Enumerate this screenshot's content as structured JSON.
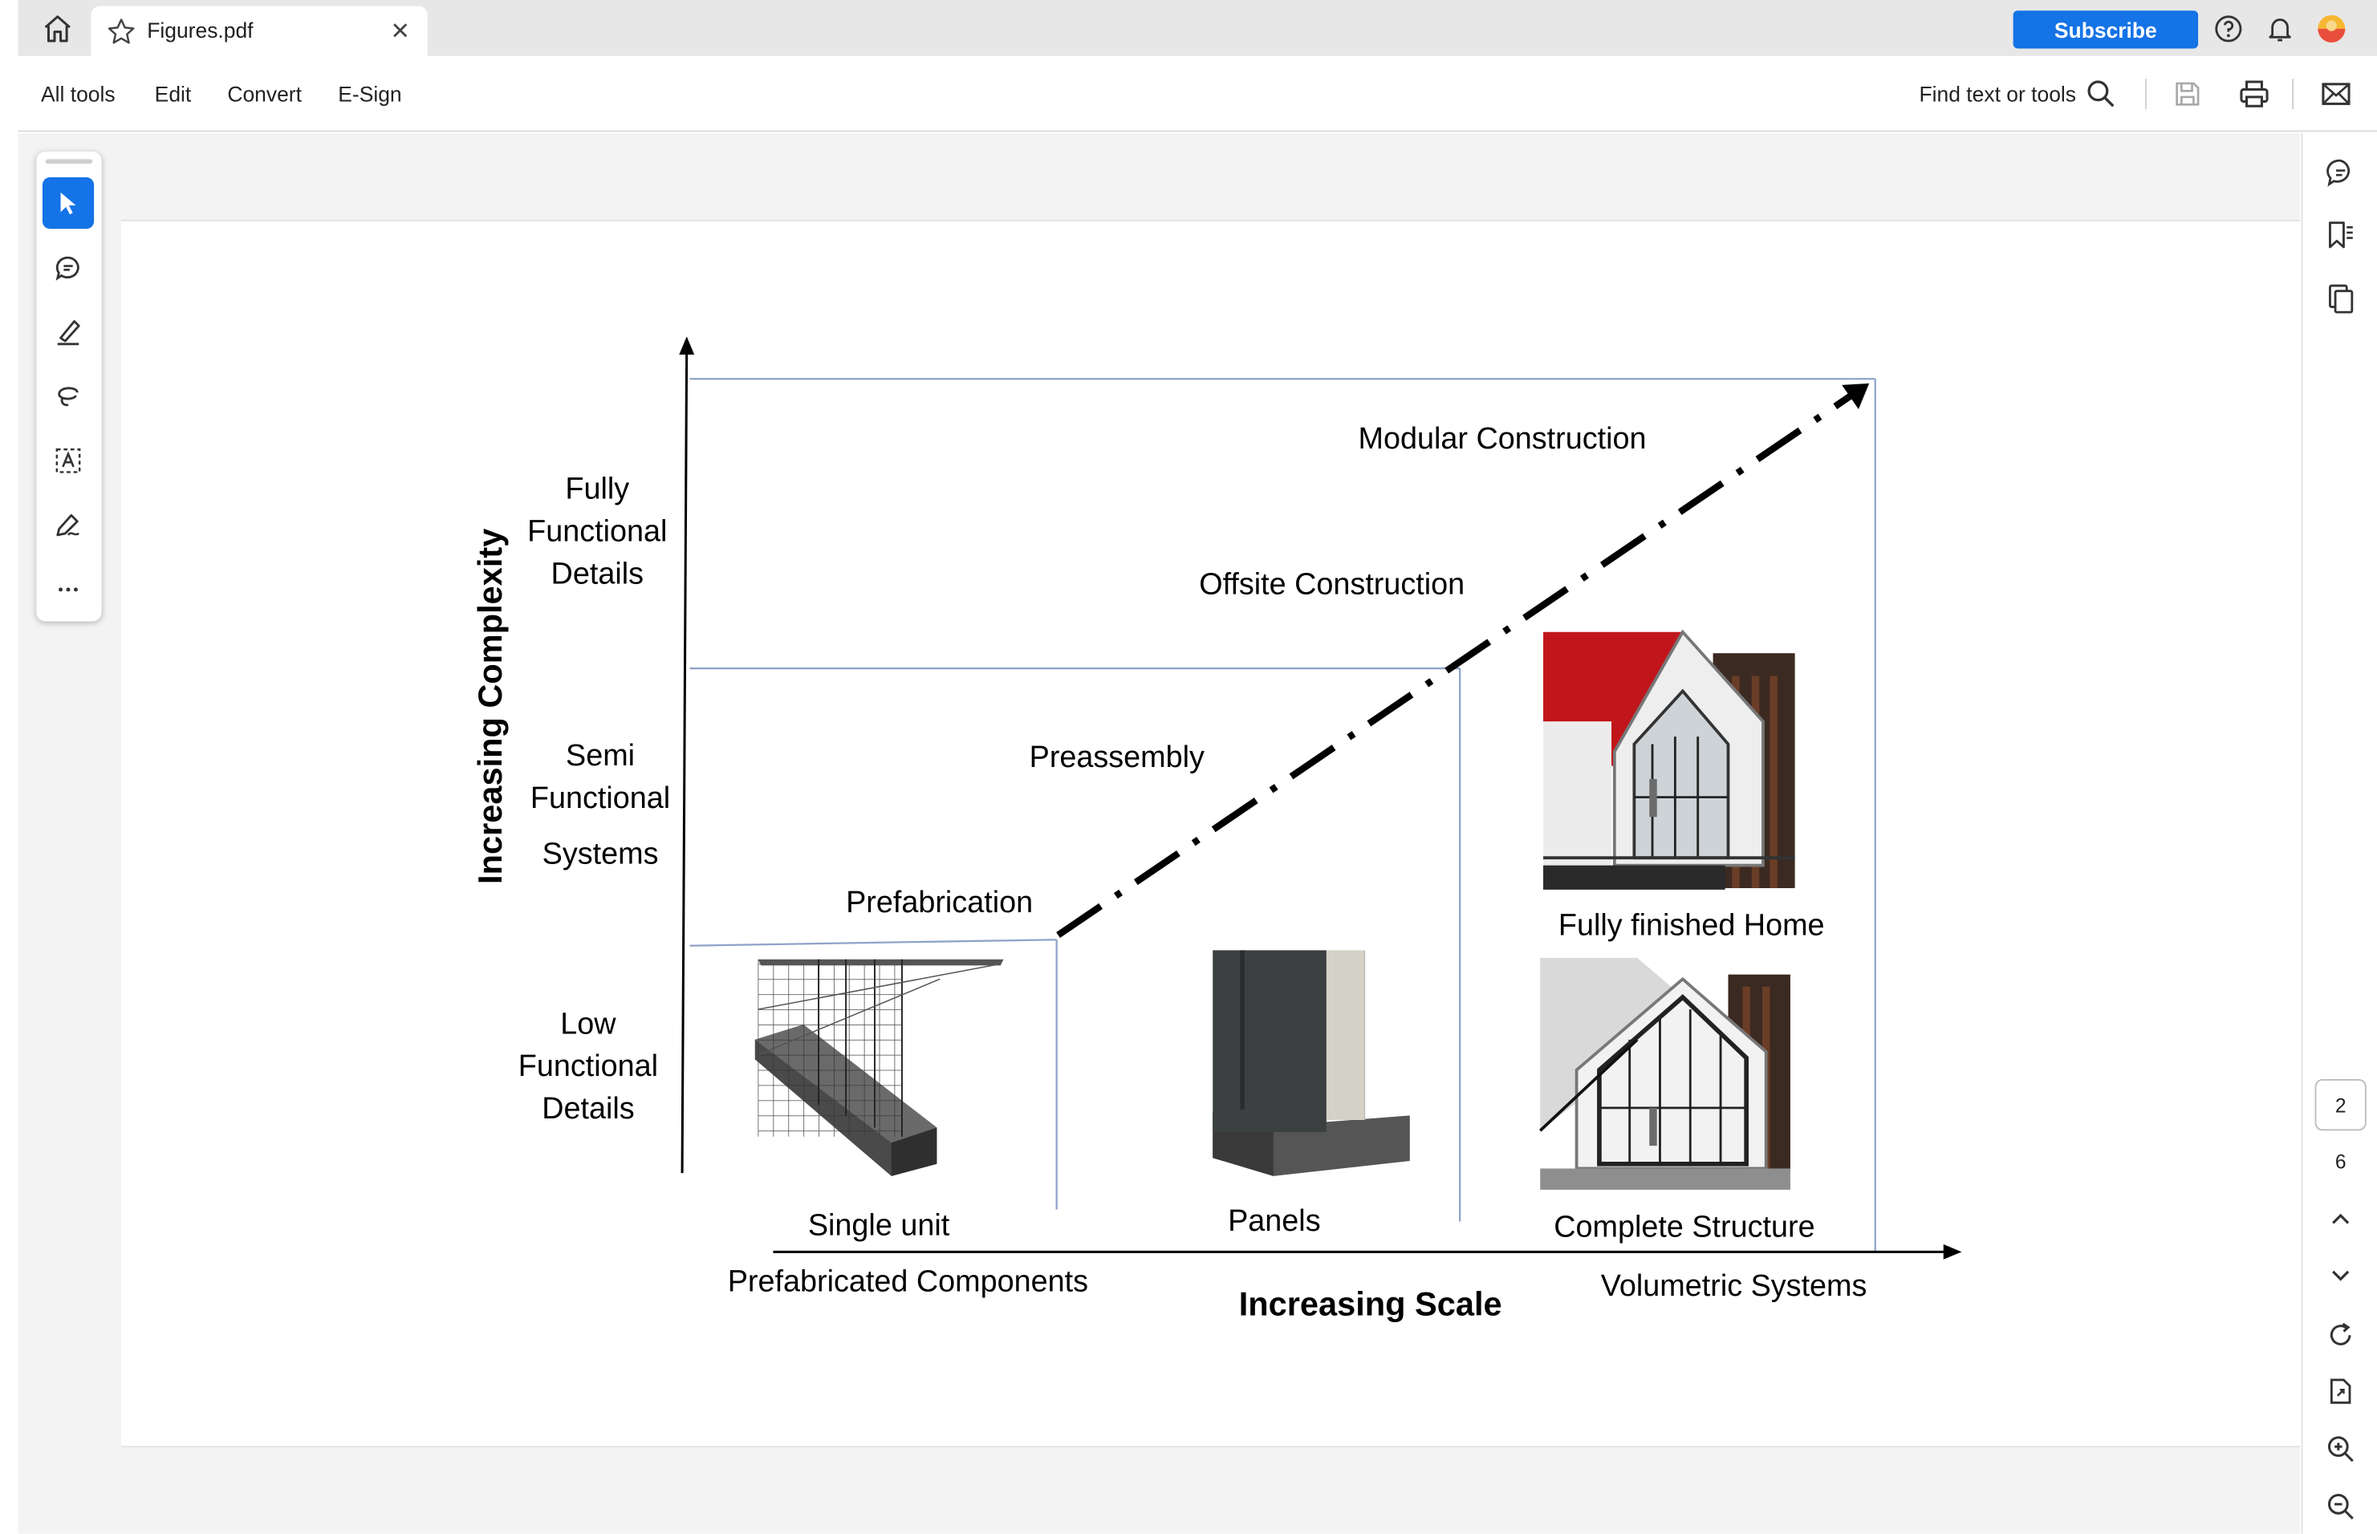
{
  "tab": {
    "title": "Figures.pdf"
  },
  "header": {
    "subscribe_label": "Subscribe"
  },
  "menu": {
    "items": [
      "All tools",
      "Edit",
      "Convert",
      "E-Sign"
    ],
    "find_label": "Find text or tools"
  },
  "pager": {
    "current": "2",
    "total": "6"
  },
  "figure": {
    "y_axis_label": "Increasing Complexity",
    "x_axis_label": "Increasing Scale",
    "levels": {
      "top": [
        "Fully",
        "Functional",
        "Details"
      ],
      "middle": [
        "Semi",
        "Functional",
        "Systems"
      ],
      "bottom": [
        "Low",
        "Functional",
        "Details"
      ]
    },
    "stages": {
      "prefabrication": "Prefabrication",
      "preassembly": "Preassembly",
      "offsite": "Offsite Construction",
      "modular": "Modular Construction"
    },
    "captions": {
      "single_unit": "Single unit",
      "panels": "Panels",
      "fully_finished": "Fully finished Home",
      "complete_structure": "Complete Structure"
    },
    "scale_labels": {
      "left": "Prefabricated Components",
      "right": "Volumetric Systems"
    }
  },
  "colors": {
    "accent": "#1473e6",
    "roof_red": "#c0161b",
    "guide_line": "#8fa3c9"
  }
}
